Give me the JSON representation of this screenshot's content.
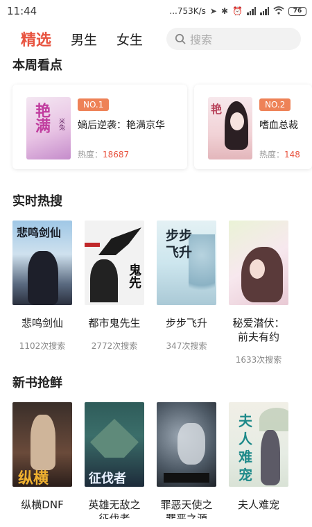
{
  "status": {
    "time": "11:44",
    "speed": "...753K/s",
    "battery": "76"
  },
  "nav": {
    "tabs": [
      "精选",
      "男生",
      "女生"
    ],
    "active": 0,
    "search_placeholder": "搜索"
  },
  "sections": {
    "weekly": "本周看点",
    "hot": "实时热搜",
    "new": "新书抢鲜"
  },
  "weekly_cards": [
    {
      "rank": "NO.1",
      "title": "嫡后逆袭：艳满京华",
      "heat_label": "热度：",
      "heat": "18687"
    },
    {
      "rank": "NO.2",
      "title": "嗜血总裁",
      "heat_label": "热度：",
      "heat": "148"
    }
  ],
  "hot_books": [
    {
      "name": "悲鸣剑仙",
      "count": "1102次搜索"
    },
    {
      "name": "都市鬼先生",
      "count": "2772次搜索"
    },
    {
      "name": "步步飞升",
      "count": "347次搜索"
    },
    {
      "name": "秘爱潜伏：前夫有约",
      "count": "1633次搜索"
    }
  ],
  "new_books": [
    {
      "name": "纵横DNF"
    },
    {
      "name": "英雄无敌之征伐者"
    },
    {
      "name": "罪恶天使之罪恶之源"
    },
    {
      "name": "夫人难宠"
    }
  ],
  "cover_text": {
    "c1": "艳满",
    "c1b": "米兔",
    "c2": "艳",
    "h1": "悲鸣剑仙",
    "h2": "鬼先",
    "h3": "步步飞升",
    "n1": "纵横",
    "n2": "征伐者",
    "n4": "夫人难宠"
  },
  "colors": {
    "accent": "#e8533f",
    "badge": "#ee8257"
  }
}
